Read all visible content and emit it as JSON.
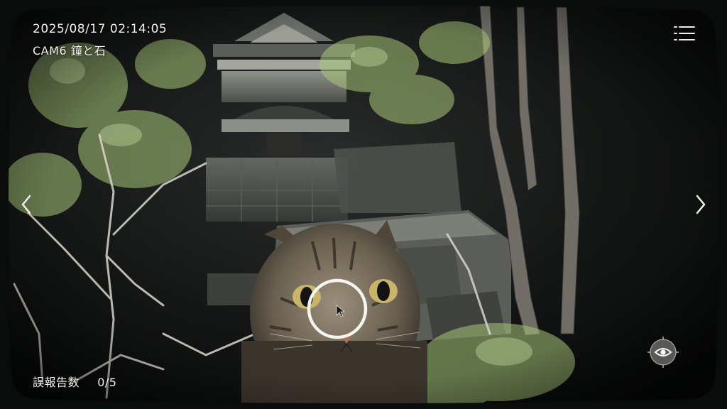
{
  "hud": {
    "timestamp": "2025/08/17  02:14:05",
    "camera_label": "CAM6 鐘と石",
    "misreport_label": "誤報告数",
    "misreport_count": "0/5"
  },
  "icons": {
    "menu": "list-menu-icon",
    "prev": "chevron-left-icon",
    "next": "chevron-right-icon",
    "view": "eye-icon",
    "reticle": "circle-reticle-icon",
    "cursor": "mouse-pointer-icon"
  },
  "colors": {
    "hud_text": "#f2f2ee",
    "foliage": "#a9c77a",
    "night": "#0c0d0d"
  }
}
